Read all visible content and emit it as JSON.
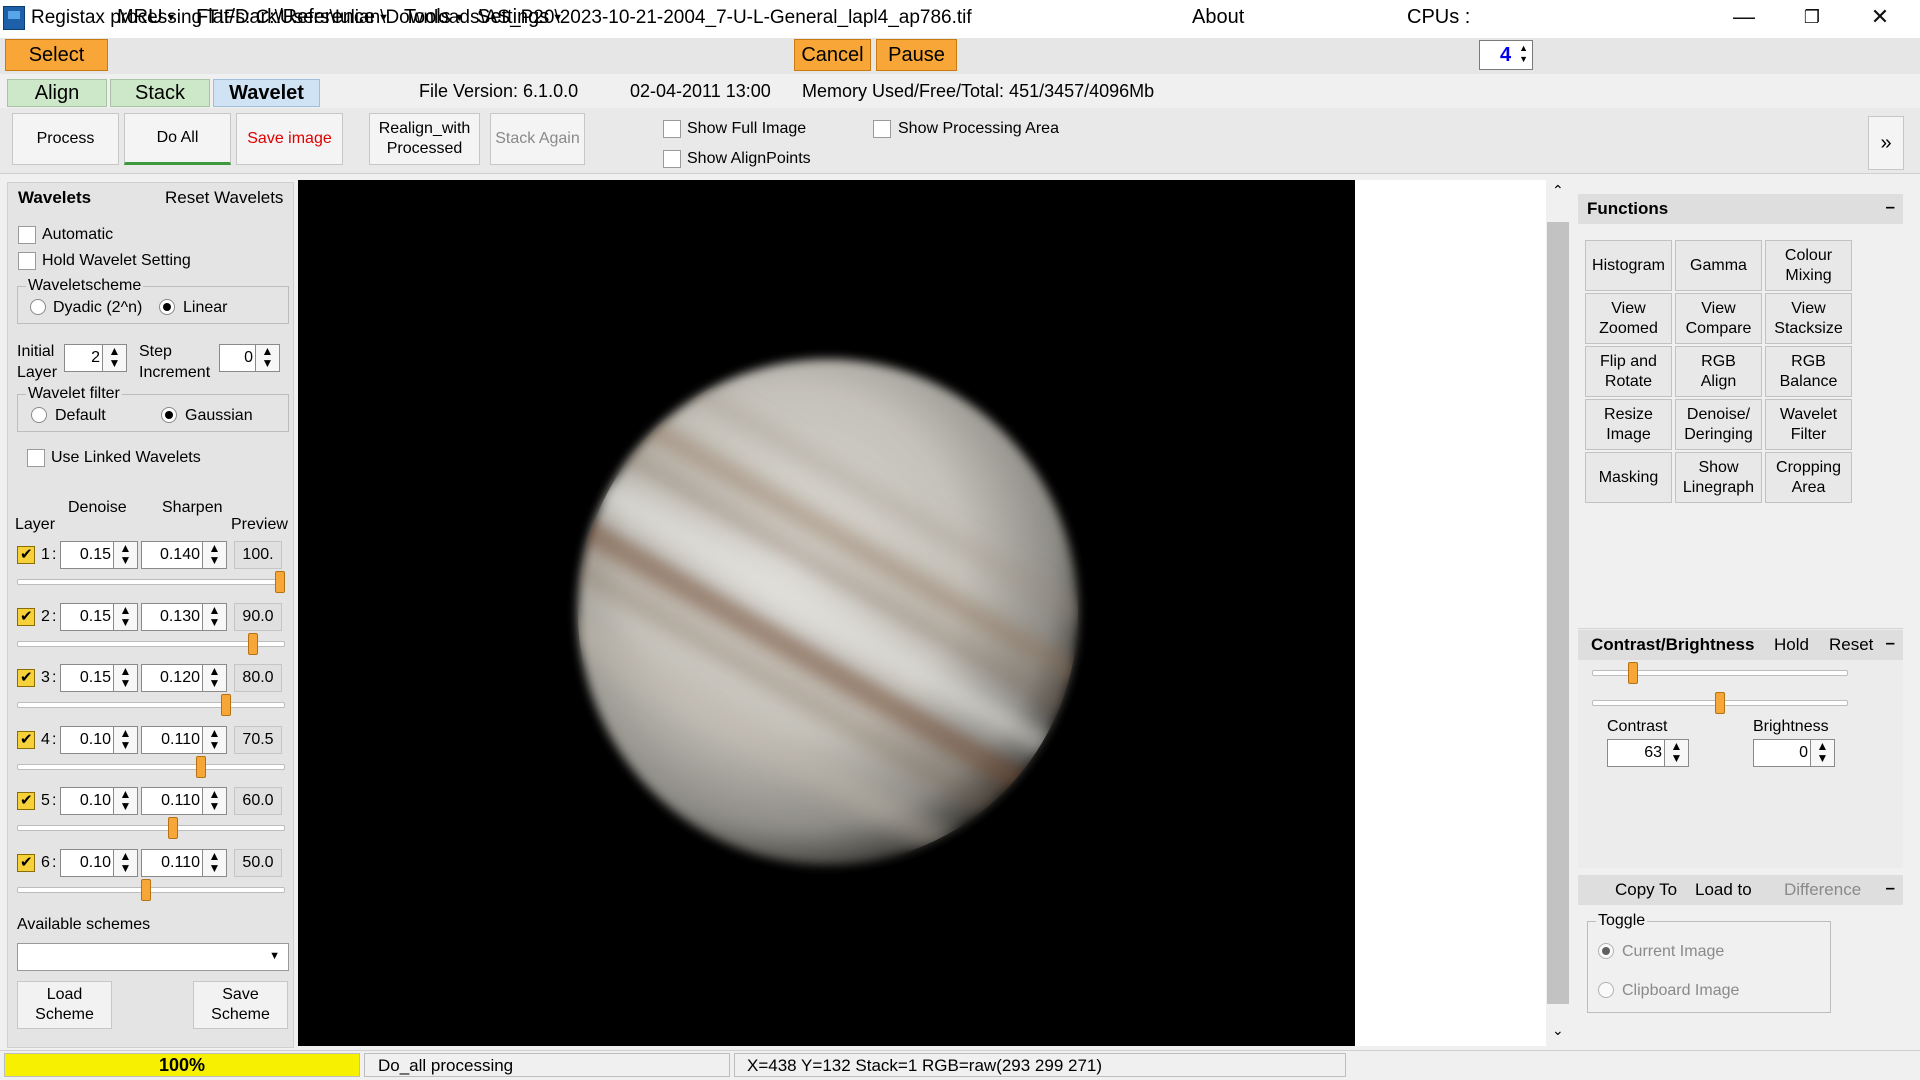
{
  "window": {
    "title": "Registax processing TIFs: C:\\Users\\Iulian\\Downloads\\AS_P20\\2023-10-21-2004_7-U-L-General_lapl4_ap786.tif",
    "minimize": "—",
    "restore": "❐",
    "close": "✕"
  },
  "menu": {
    "select": "Select",
    "mru": "MRU",
    "flat": "Flat/Dark/Reference",
    "tools": "Tools",
    "settings": "Settings",
    "cancel": "Cancel",
    "pause": "Pause",
    "about": "About",
    "cpus_label": "CPUs :",
    "cpus_value": "4"
  },
  "tabs": {
    "align": "Align",
    "stack": "Stack",
    "wavelet": "Wavelet",
    "file_version": "File Version: 6.1.0.0",
    "date": "02-04-2011 13:00",
    "memory": "Memory Used/Free/Total: 451/3457/4096Mb"
  },
  "toolbar": {
    "process": "Process",
    "do_all": "Do All",
    "save_image": "Save image",
    "realign_line1": "Realign_with",
    "realign_line2": "Processed",
    "stack_again": "Stack Again",
    "show_full_image": "Show Full Image",
    "show_alignpoints": "Show AlignPoints",
    "show_processing_area": "Show Processing Area",
    "expand": "»"
  },
  "wavelets": {
    "header": "Wavelets",
    "reset": "Reset Wavelets",
    "automatic": "Automatic",
    "hold": "Hold Wavelet Setting",
    "scheme_title": "Waveletscheme",
    "dyadic": "Dyadic (2^n)",
    "linear": "Linear",
    "initial_1": "Initial",
    "initial_2": "Layer",
    "initial_value": "2",
    "step_1": "Step",
    "step_2": "Increment",
    "step_value": "0",
    "filter_title": "Wavelet filter",
    "default": "Default",
    "gaussian": "Gaussian",
    "use_linked": "Use Linked Wavelets",
    "col_denoise": "Denoise",
    "col_sharpen": "Sharpen",
    "col_layer": "Layer",
    "col_preview": "Preview",
    "layers": [
      {
        "num": "1",
        "denoise": "0.15",
        "sharpen": "0.140",
        "preview": "100.",
        "level": 100
      },
      {
        "num": "2",
        "denoise": "0.15",
        "sharpen": "0.130",
        "preview": "90.0",
        "level": 90
      },
      {
        "num": "3",
        "denoise": "0.15",
        "sharpen": "0.120",
        "preview": "80.0",
        "level": 80
      },
      {
        "num": "4",
        "denoise": "0.10",
        "sharpen": "0.110",
        "preview": "70.5",
        "level": 70.5
      },
      {
        "num": "5",
        "denoise": "0.10",
        "sharpen": "0.110",
        "preview": "60.0",
        "level": 60
      },
      {
        "num": "6",
        "denoise": "0.10",
        "sharpen": "0.110",
        "preview": "50.0",
        "level": 50
      }
    ],
    "available_schemes": "Available schemes",
    "load_1": "Load",
    "load_2": "Scheme",
    "save_1": "Save",
    "save_2": "Scheme"
  },
  "functions": {
    "header": "Functions",
    "collapse": "–",
    "buttons": [
      [
        "Histogram",
        ""
      ],
      [
        "Gamma",
        ""
      ],
      [
        "Colour",
        "Mixing"
      ],
      [
        "View",
        "Zoomed"
      ],
      [
        "View",
        "Compare"
      ],
      [
        "View",
        "Stacksize"
      ],
      [
        "Flip and",
        "Rotate"
      ],
      [
        "RGB",
        "Align"
      ],
      [
        "RGB",
        "Balance"
      ],
      [
        "Resize",
        "Image"
      ],
      [
        "Denoise/",
        "Deringing"
      ],
      [
        "Wavelet",
        "Filter"
      ],
      [
        "Masking",
        ""
      ],
      [
        "Show",
        "Linegraph"
      ],
      [
        "Cropping",
        "Area"
      ]
    ]
  },
  "contrast": {
    "header": "Contrast/Brightness",
    "hold": "Hold",
    "reset": "Reset",
    "collapse": "–",
    "contrast_label": "Contrast",
    "contrast_value": "63",
    "brightness_label": "Brightness",
    "brightness_value": "0"
  },
  "copy": {
    "copy_to": "Copy To",
    "load_to": "Load to",
    "difference": "Difference",
    "collapse": "–",
    "toggle_title": "Toggle",
    "current_image": "Current Image",
    "clipboard_image": "Clipboard Image"
  },
  "status": {
    "progress": "100%",
    "progress_level": 100,
    "message": "Do_all processing",
    "coords": "X=438 Y=132 Stack=1 RGB=raw(293 299 271)"
  },
  "colors": {
    "accent_orange": "#f7a637",
    "tab_green": "#cde8c8",
    "tab_blue": "#cfe3f5",
    "progress_yellow": "#f7f000",
    "save_red": "#e00000"
  },
  "icons": {
    "app": "registax-icon",
    "scroll_up": "⌃",
    "scroll_down": "⌄"
  }
}
